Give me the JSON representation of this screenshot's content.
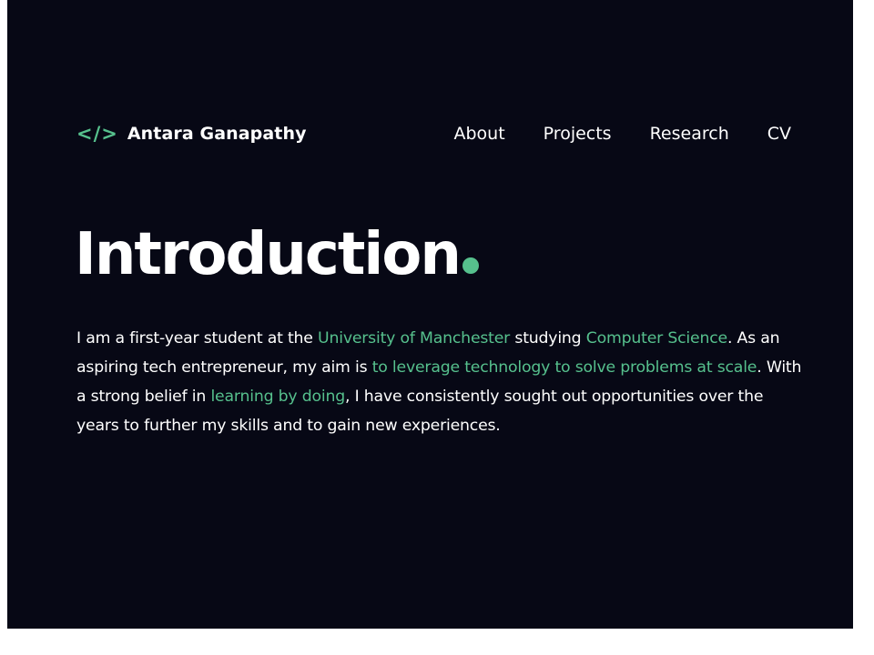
{
  "brand": {
    "icon": "</>",
    "icon_name": "code-brackets-icon",
    "name": "Antara Ganapathy"
  },
  "nav": {
    "about": "About",
    "projects": "Projects",
    "research": "Research",
    "cv": "CV"
  },
  "hero": {
    "title": "Introduction"
  },
  "intro": {
    "p1": "I am a first-year student at the ",
    "h1": "University of Manchester",
    "p2": " studying ",
    "h2": "Computer Science",
    "p3": ". As an aspiring tech entrepreneur, my aim is ",
    "h3": "to leverage technology to solve problems at scale",
    "p4": ". With a strong belief in ",
    "h4": "learning by doing",
    "p5": ", I have consistently sought out opportunities over the years to further my skills and to gain new experiences."
  },
  "colors": {
    "background": "#070815",
    "accent": "#56c08d",
    "text": "#ffffff",
    "page_margin": "#ffffff"
  }
}
